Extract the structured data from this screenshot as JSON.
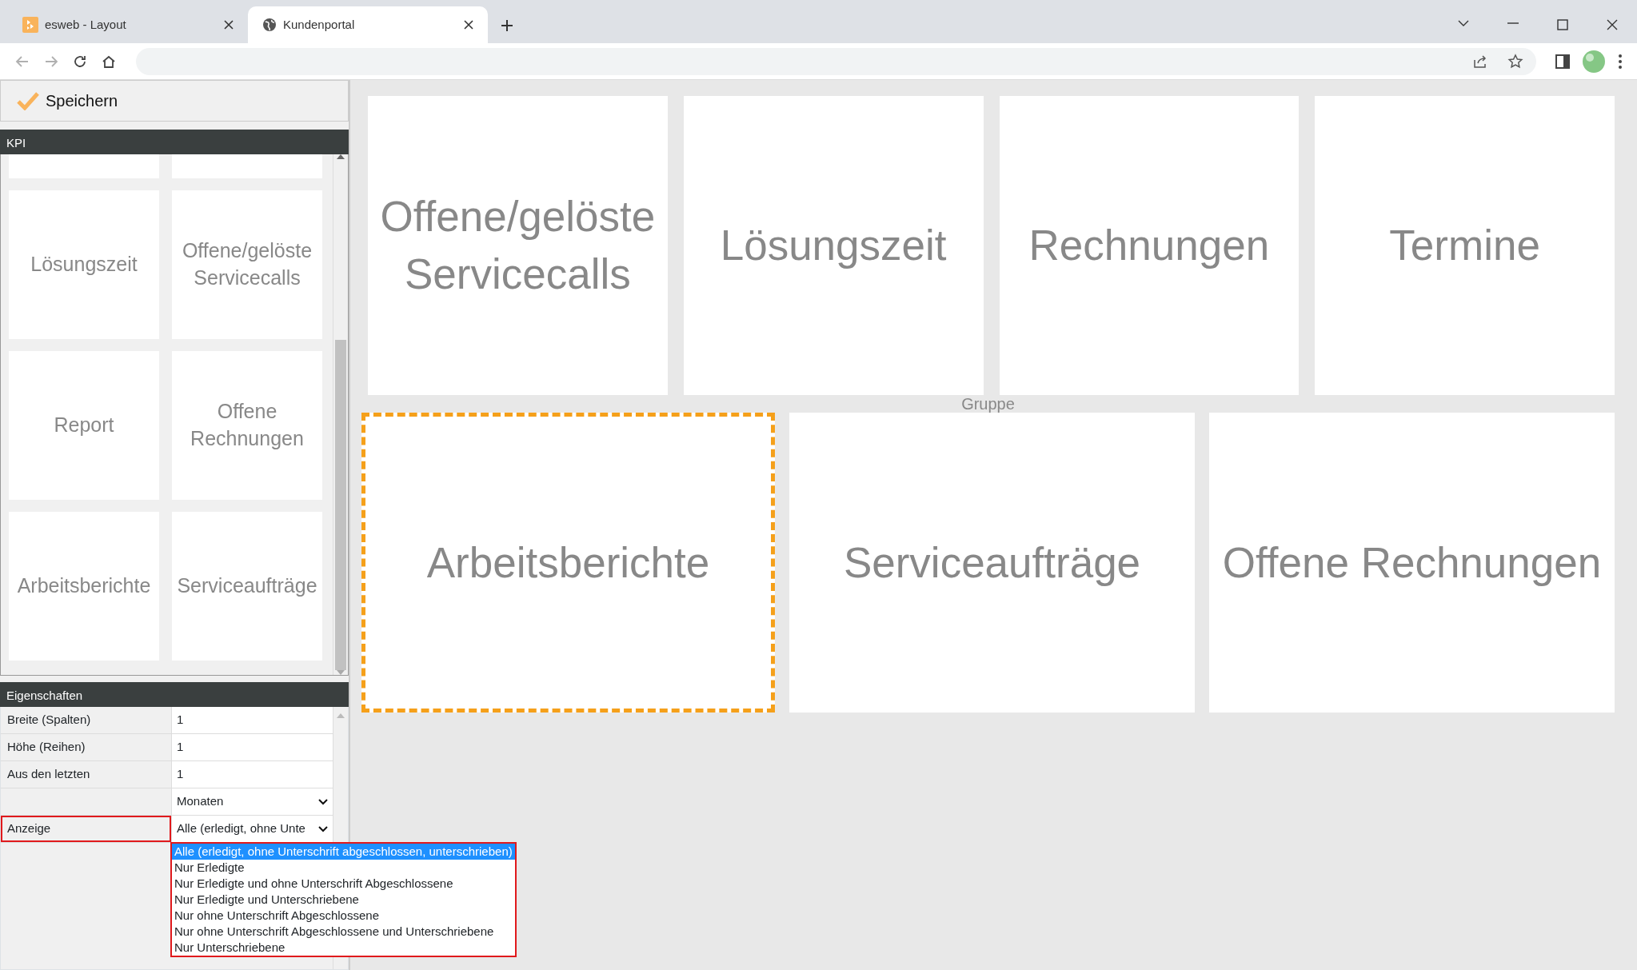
{
  "browser": {
    "tabs": [
      {
        "title": "esweb - Layout",
        "kind": "app",
        "selected": false
      },
      {
        "title": "Kundenportal",
        "kind": "globe",
        "selected": true
      }
    ],
    "nav_buttons": [
      {
        "kind": "back",
        "disabled": true
      },
      {
        "kind": "forward",
        "disabled": true
      },
      {
        "kind": "reload",
        "disabled": false
      },
      {
        "kind": "home",
        "disabled": false
      }
    ]
  },
  "toolbar": {
    "save_button": "Speichern"
  },
  "kpi_panel": {
    "title": "KPI",
    "tile_rows": [
      [
        "Lösungszeit",
        "Offene/gelöste Servicecalls"
      ],
      [
        "Report",
        "Offene Rechnungen"
      ],
      [
        "Arbeitsberichte",
        "Serviceaufträge"
      ]
    ]
  },
  "properties": {
    "title": "Eigenschaften",
    "rows": [
      {
        "label": "Breite (Spalten)",
        "value": "1",
        "kind": "text",
        "highlighted": false
      },
      {
        "label": "Höhe (Reihen)",
        "value": "1",
        "kind": "text",
        "highlighted": false
      },
      {
        "label": "Aus den letzten",
        "value": "1",
        "kind": "text",
        "highlighted": false
      },
      {
        "label": "",
        "value": "Monaten",
        "kind": "select",
        "highlighted": false
      },
      {
        "label": "Anzeige",
        "value": "Alle (erledigt, ohne Unte",
        "kind": "select",
        "highlighted": true
      }
    ],
    "dropdown": [
      {
        "label": "Alle (erledigt, ohne Unterschrift abgeschlossen, unterschrieben)",
        "selected": true
      },
      {
        "label": "Nur Erledigte",
        "selected": false
      },
      {
        "label": "Nur Erledigte und ohne Unterschrift Abgeschlossene",
        "selected": false
      },
      {
        "label": "Nur Erledigte und Unterschriebene",
        "selected": false
      },
      {
        "label": "Nur ohne Unterschrift Abgeschlossene",
        "selected": false
      },
      {
        "label": "Nur ohne Unterschrift Abgeschlossene und Unterschriebene",
        "selected": false
      },
      {
        "label": "Nur Unterschriebene",
        "selected": false
      }
    ]
  },
  "dashboard": {
    "group_label": "Gruppe",
    "rows": [
      [
        {
          "label": "Offene/gelöste Servicecalls",
          "selected": false
        },
        {
          "label": "Lösungszeit",
          "selected": false
        },
        {
          "label": "Rechnungen",
          "selected": false
        },
        {
          "label": "Termine",
          "selected": false
        }
      ],
      [
        {
          "label": "Arbeitsberichte",
          "selected": true
        },
        {
          "label": "Serviceaufträge",
          "selected": false
        },
        {
          "label": "Offene Rechnungen",
          "selected": false
        }
      ]
    ]
  }
}
